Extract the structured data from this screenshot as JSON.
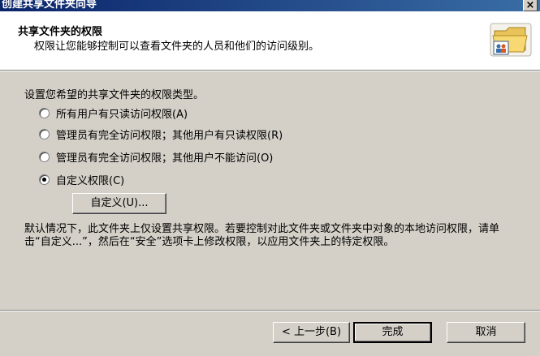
{
  "window": {
    "title": "创建共享文件夹向导",
    "close_label": "×"
  },
  "header": {
    "title": "共享文件夹的权限",
    "subtitle": "权限让您能够控制可以查看文件夹的人员和他们的访问级别。"
  },
  "main": {
    "instruction": "设置您希望的共享文件夹的权限类型。",
    "options": [
      {
        "label": "所有用户有只读访问权限(A)",
        "checked": false
      },
      {
        "label": "管理员有完全访问权限；其他用户有只读权限(R)",
        "checked": false
      },
      {
        "label": "管理员有完全访问权限；其他用户不能访问(O)",
        "checked": false
      },
      {
        "label": "自定义权限(C)",
        "checked": true
      }
    ],
    "custom_button": "自定义(U)...",
    "description": "默认情况下，此文件夹上仅设置共享权限。若要控制对此文件夹或文件夹中对象的本地访问权限，请单击“自定义...”，然后在“安全”选项卡上修改权限，以应用文件夹上的特定权限。"
  },
  "footer": {
    "back": "< 上一步(B)",
    "finish": "完成",
    "cancel": "取消"
  },
  "icons": {
    "header_icon": "shared-folder-icon"
  }
}
